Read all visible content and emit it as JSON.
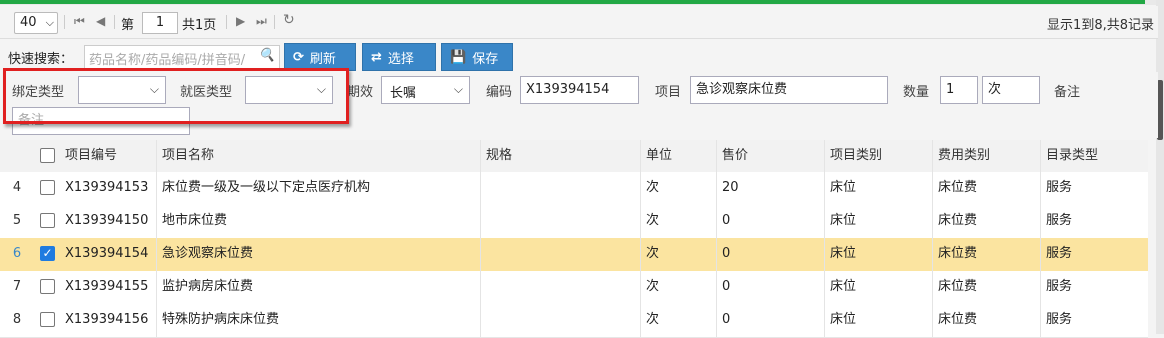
{
  "pager": {
    "page_size": "40",
    "page_prefix": "第",
    "page_number": "1",
    "page_suffix": "共1页",
    "info": "显示1到8,共8记录"
  },
  "toolbar": {
    "quick_search_label": "快速搜索：",
    "search_placeholder": "药品名称/药品编码/拼音码/",
    "refresh_label": "刷新",
    "select_label": "选择",
    "save_label": "保存"
  },
  "form": {
    "bind_type_label": "绑定类型",
    "bind_type_value": "",
    "visit_type_label": "就医类型",
    "visit_type_value": "",
    "period_label": "期效",
    "period_value": "长嘱",
    "code_label": "编码",
    "code_value": "X139394154",
    "item_label": "项目",
    "item_value": "急诊观察床位费",
    "qty_label": "数量",
    "qty_value": "1",
    "unit_value": "次",
    "note_label": "备注",
    "note_placeholder": "备注"
  },
  "table": {
    "headers": [
      "项目编号",
      "项目名称",
      "规格",
      "单位",
      "售价",
      "项目类别",
      "费用类别",
      "目录类型"
    ],
    "rows": [
      {
        "n": "4",
        "code": "X139394153",
        "name": "床位费一级及一级以下定点医疗机构",
        "spec": "",
        "unit": "次",
        "price": "20",
        "cat": "床位",
        "fee": "床位费",
        "dir": "服务",
        "checked": false
      },
      {
        "n": "5",
        "code": "X139394150",
        "name": "地市床位费",
        "spec": "",
        "unit": "次",
        "price": "0",
        "cat": "床位",
        "fee": "床位费",
        "dir": "服务",
        "checked": false
      },
      {
        "n": "6",
        "code": "X139394154",
        "name": "急诊观察床位费",
        "spec": "",
        "unit": "次",
        "price": "0",
        "cat": "床位",
        "fee": "床位费",
        "dir": "服务",
        "checked": true
      },
      {
        "n": "7",
        "code": "X139394155",
        "name": "监护病房床位费",
        "spec": "",
        "unit": "次",
        "price": "0",
        "cat": "床位",
        "fee": "床位费",
        "dir": "服务",
        "checked": false
      },
      {
        "n": "8",
        "code": "X139394156",
        "name": "特殊防护病床床位费",
        "spec": "",
        "unit": "次",
        "price": "0",
        "cat": "床位",
        "fee": "床位费",
        "dir": "服务",
        "checked": false
      }
    ]
  },
  "colors": {
    "accent": "#3a87c8",
    "selected_row": "#fbe4a0",
    "highlight_box": "#e02020"
  }
}
